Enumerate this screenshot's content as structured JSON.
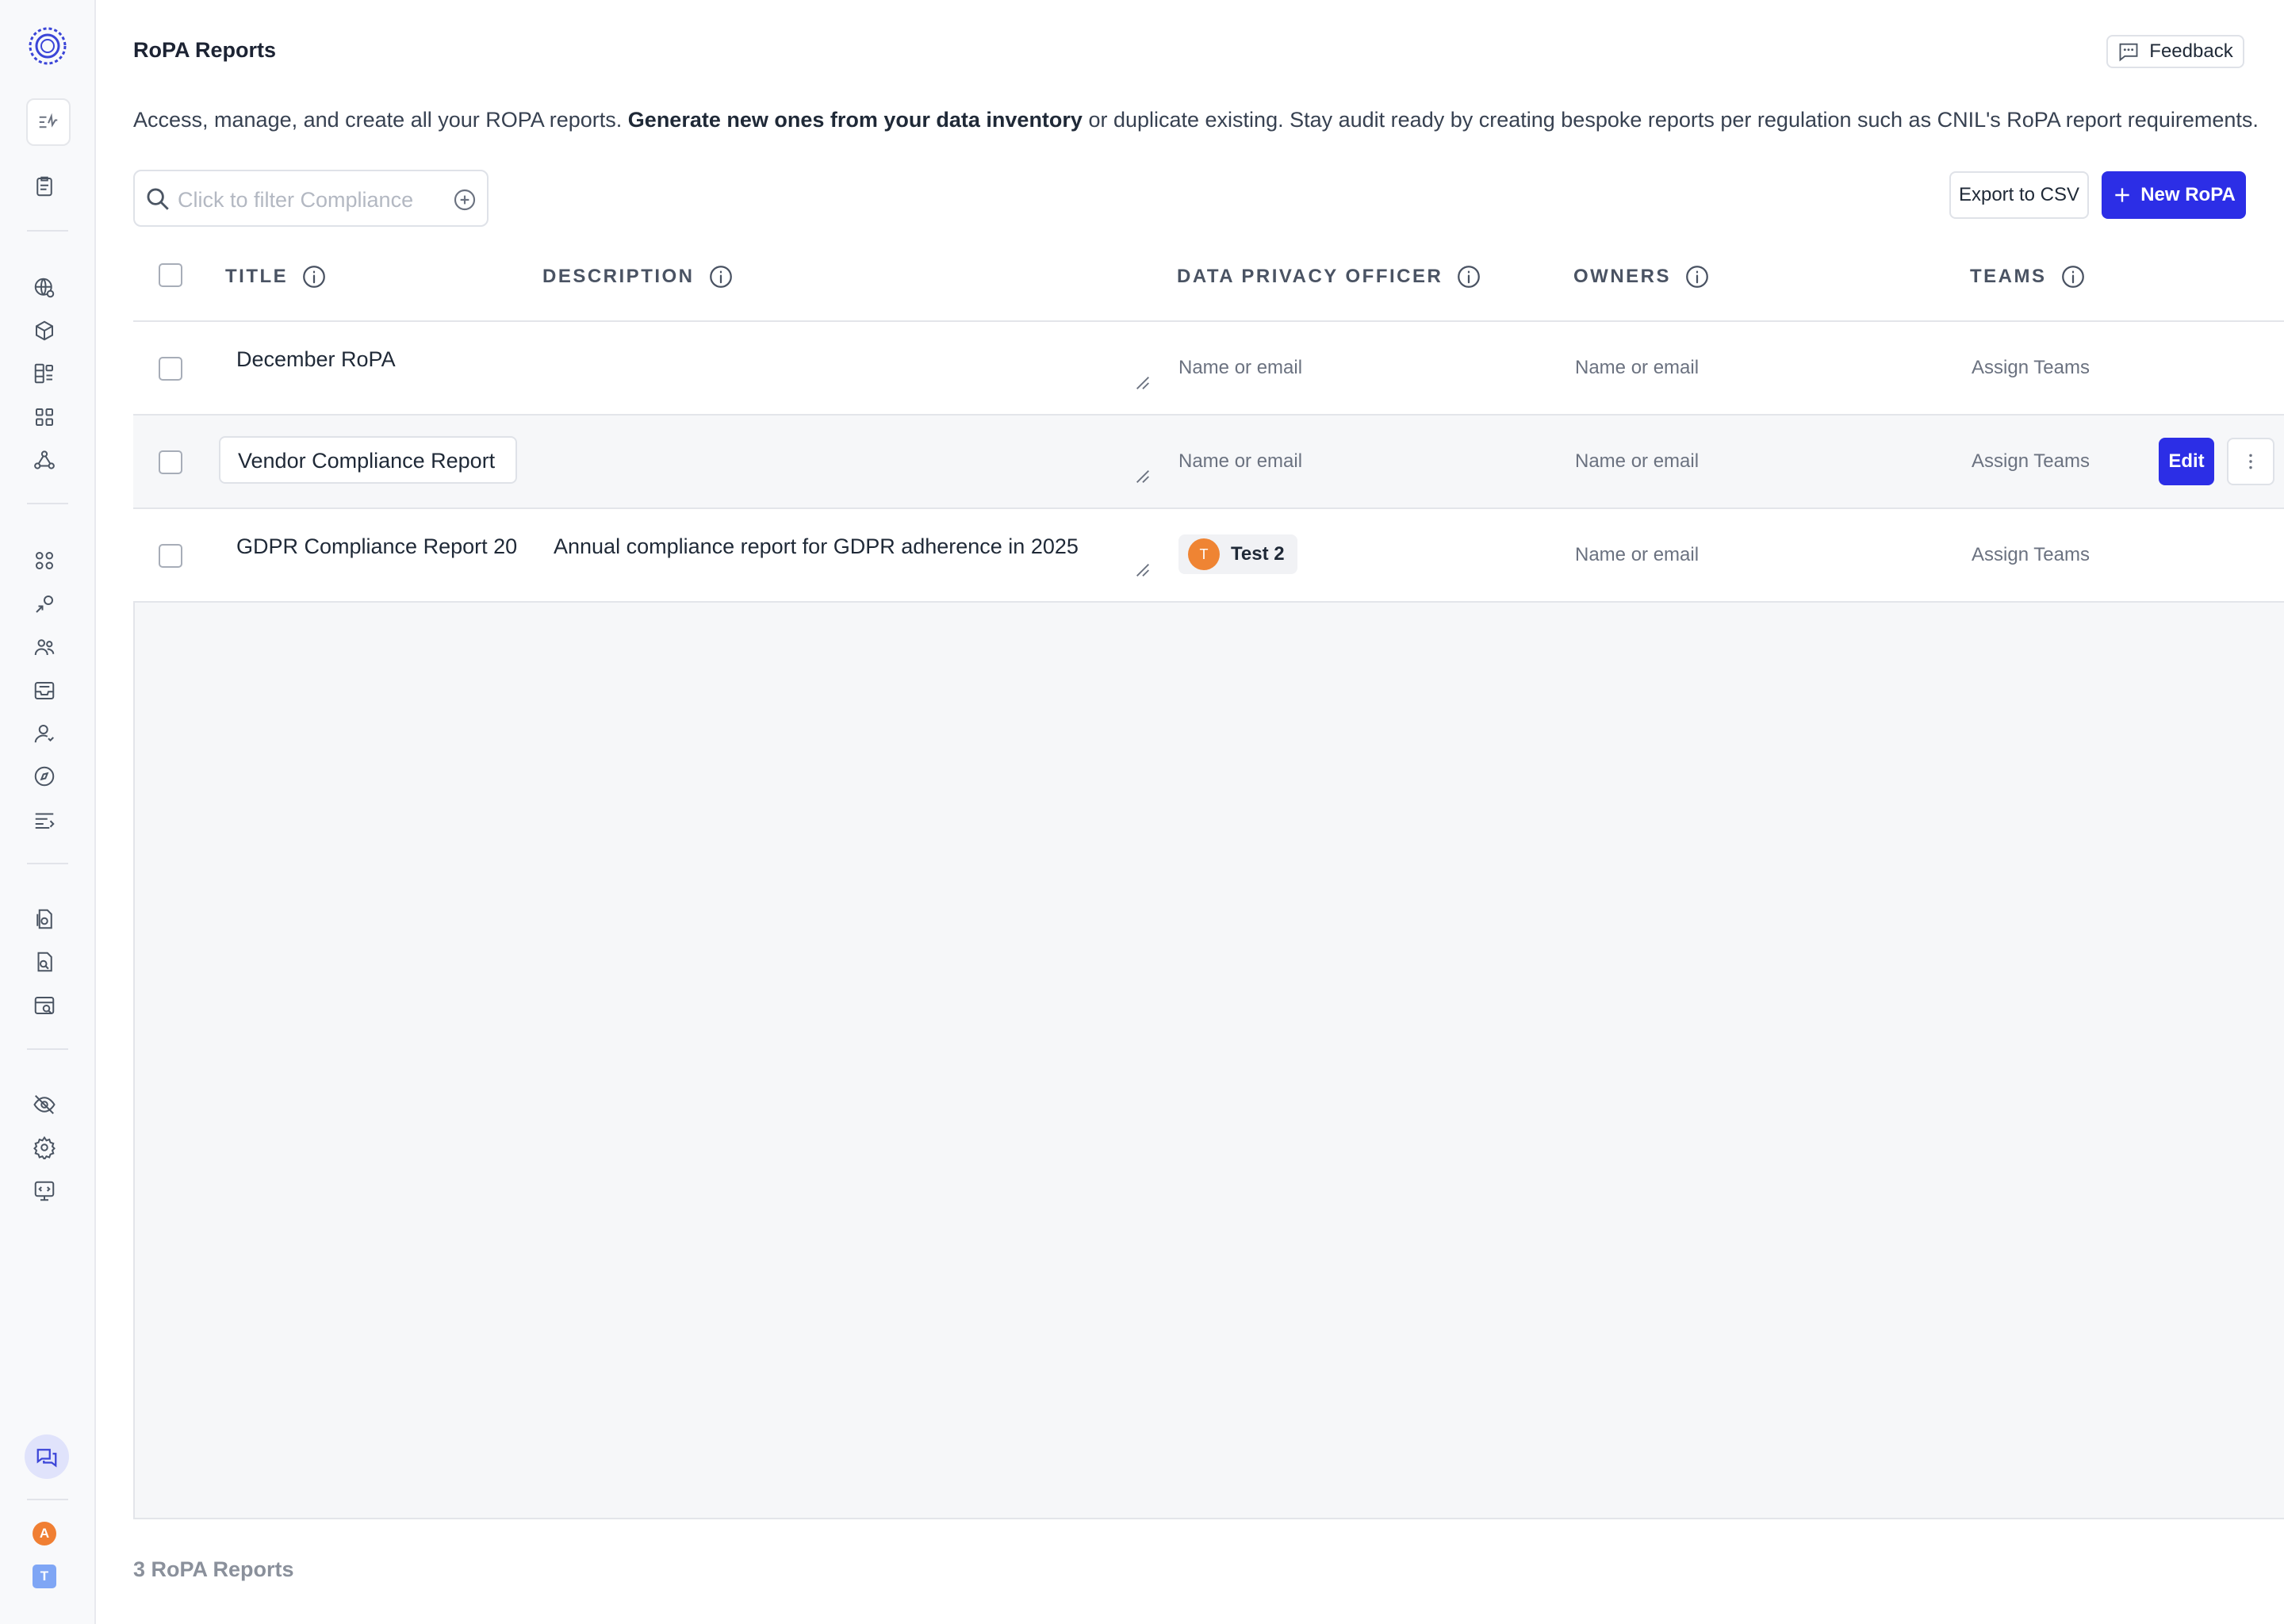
{
  "page": {
    "title": "RoPA Reports",
    "description_pre": "Access, manage, and create all your ROPA reports. ",
    "description_bold": "Generate new ones from your data inventory",
    "description_post": " or duplicate existing. Stay audit ready by creating bespoke reports per regulation such as CNIL's RoPA report requirements.",
    "feedback_label": "Feedback",
    "footer_count": "3 RoPA Reports"
  },
  "toolbar": {
    "filter_placeholder": "Click to filter Compliance I",
    "export_label": "Export to CSV",
    "new_label": "New RoPA"
  },
  "table": {
    "columns": [
      "TITLE",
      "DESCRIPTION",
      "DATA PRIVACY OFFICER",
      "OWNERS",
      "TEAMS"
    ],
    "rows": [
      {
        "title": "December RoPA",
        "description": "",
        "dpo": "Name or email",
        "owners": "Name or email",
        "teams": "Assign Teams"
      },
      {
        "title": "Vendor Compliance Report",
        "description": "",
        "dpo": "Name or email",
        "owners": "Name or email",
        "teams": "Assign Teams",
        "edit_label": "Edit"
      },
      {
        "title": "GDPR Compliance Report 20",
        "description": "Annual compliance report for GDPR adherence in 2025",
        "dpo_chip": {
          "initial": "T",
          "name": "Test 2"
        },
        "owners": "Name or email",
        "teams": "Assign Teams"
      }
    ]
  },
  "sidebar": {
    "icons": [
      "app-logo-icon",
      "activity-icon",
      "clipboard-icon",
      "globe-icon",
      "cube-icon",
      "data-list-icon",
      "grid-icon",
      "network-icon",
      "apps-icon",
      "integration-icon",
      "users-icon",
      "inbox-icon",
      "user-icon",
      "compass-icon",
      "list-icon",
      "file-doc-icon",
      "file-search-icon",
      "browser-search-icon",
      "eye-off-icon",
      "gear-icon",
      "monitor-code-icon",
      "chat-icon"
    ],
    "avatar_a": "A",
    "avatar_t": "T"
  },
  "colors": {
    "accent": "#2c2ee6",
    "avatar_orange": "#ef8433",
    "avatar_blue": "#7fa6f5"
  }
}
